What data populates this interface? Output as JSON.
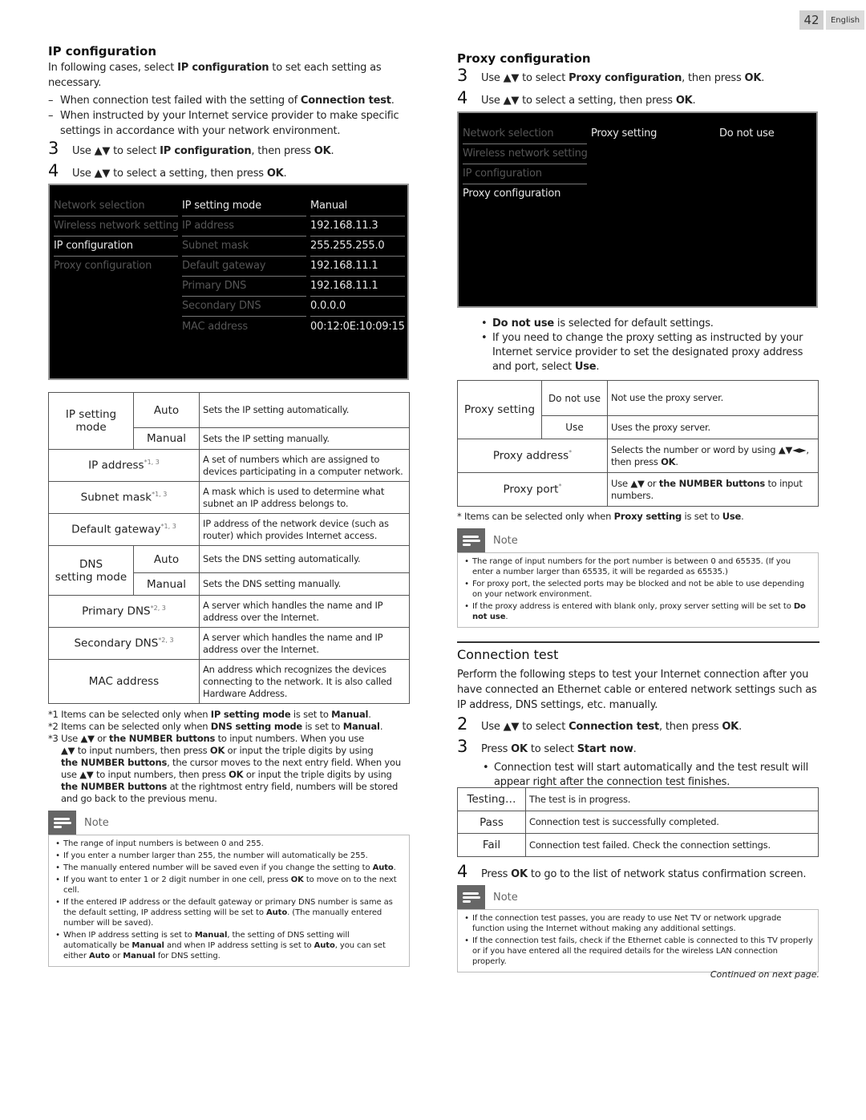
{
  "page": {
    "number": "42",
    "language": "English"
  },
  "ip_config": {
    "title": "IP configuration",
    "intro": [
      "In following cases, select ",
      "IP configuration",
      " to set each setting as necessary."
    ],
    "cases": [
      [
        "When connection test failed with the setting of ",
        "Connection test",
        "."
      ],
      [
        "When instructed by your Internet service provider to make specific settings in accordance with your network environment.",
        "",
        ""
      ]
    ],
    "steps": [
      {
        "num": "3",
        "parts": [
          "Use ▲▼ to select ",
          "IP configuration",
          ", then press ",
          "OK",
          "."
        ]
      },
      {
        "num": "4",
        "parts": [
          "Use ▲▼ to select a setting, then press ",
          "OK",
          "."
        ]
      }
    ],
    "screen": {
      "menu": [
        "Network selection",
        "Wireless network setting",
        "IP configuration",
        "Proxy configuration"
      ],
      "menu_active": 2,
      "settings": [
        {
          "label": "IP setting mode",
          "value": "Manual",
          "active": true
        },
        {
          "label": "IP address",
          "value": "192.168.11.3"
        },
        {
          "label": "Subnet mask",
          "value": "255.255.255.0"
        },
        {
          "label": "Default gateway",
          "value": "192.168.11.1"
        },
        {
          "label": "Primary DNS",
          "value": "192.168.11.1"
        },
        {
          "label": "Secondary DNS",
          "value": "0.0.0.0"
        },
        {
          "label": "MAC address",
          "value": "00:12:0E:10:09:15"
        }
      ]
    },
    "table": {
      "ip_setting_mode": {
        "label": "IP setting mode",
        "options": [
          {
            "opt": "Auto",
            "desc": "Sets the IP setting automatically."
          },
          {
            "opt": "Manual",
            "desc": "Sets the IP setting manually."
          }
        ]
      },
      "ip_address": {
        "label": "IP address",
        "fn": "*1, 3",
        "desc": "A set of numbers which are assigned to devices participating in a computer network."
      },
      "subnet_mask": {
        "label": "Subnet mask",
        "fn": "*1, 3",
        "desc": "A mask which is used to determine what subnet an IP address belongs to."
      },
      "default_gateway": {
        "label": "Default gateway",
        "fn": "*1, 3",
        "desc": "IP address of the network device (such as router) which provides Internet access."
      },
      "dns_setting_mode": {
        "label1": "DNS",
        "label2": "setting mode",
        "options": [
          {
            "opt": "Auto",
            "desc": "Sets the DNS setting automatically."
          },
          {
            "opt": "Manual",
            "desc": "Sets the DNS setting manually."
          }
        ]
      },
      "primary_dns": {
        "label": "Primary DNS",
        "fn": "*2, 3",
        "desc": "A server which handles the name and IP address over the Internet."
      },
      "secondary_dns": {
        "label": "Secondary DNS",
        "fn": "*2, 3",
        "desc": "A server which handles the name and IP address over the Internet."
      },
      "mac_address": {
        "label": "MAC address",
        "desc": "An address which recognizes the devices connecting to the network. It is also called Hardware Address."
      }
    },
    "footnotes": {
      "f1": [
        "*1 Items can be selected only when ",
        "IP setting mode",
        " is set to ",
        "Manual",
        "."
      ],
      "f2": [
        "*2 Items can be selected only when ",
        "DNS setting mode",
        " is set to ",
        "Manual",
        "."
      ],
      "f3_a": [
        "*3 Use ▲▼ or ",
        "the NUMBER buttons",
        " to input numbers. When you use"
      ],
      "f3_b": [
        "▲▼ to input numbers, then press ",
        "OK",
        " or input the triple digits by using"
      ],
      "f3_c": [
        "the NUMBER buttons",
        ", the cursor moves to the next entry field. When you"
      ],
      "f3_d": [
        "use ▲▼ to input numbers, then press ",
        "OK",
        " or input the triple digits by using"
      ],
      "f3_e": [
        "the NUMBER buttons",
        " at the rightmost entry field, numbers will be stored"
      ],
      "f3_f": [
        "and go back to the previous menu."
      ]
    },
    "note": {
      "label": "Note",
      "items": [
        [
          "The range of input numbers is between 0 and 255."
        ],
        [
          "If you enter a number larger than 255, the number will automatically be 255."
        ],
        [
          "The manually entered number will be saved even if you change the setting to ",
          "Auto",
          "."
        ],
        [
          "If you want to enter 1 or 2 digit number in one cell, press ",
          "OK",
          " to move on to the next cell."
        ],
        [
          "If the entered IP address or the default gateway or primary DNS number is same as the default setting, IP address setting will be set to ",
          "Auto",
          ". (The manually entered number will be saved)."
        ],
        [
          "When IP address setting is set to ",
          "Manual",
          ", the setting of DNS setting will automatically be ",
          "Manual",
          " and when IP address setting is set to ",
          "Auto",
          ", you can set either ",
          "Auto",
          " or ",
          "Manual",
          " for DNS setting."
        ]
      ]
    }
  },
  "proxy_config": {
    "title": "Proxy configuration",
    "steps": [
      {
        "num": "3",
        "parts": [
          "Use ▲▼ to select ",
          "Proxy configuration",
          ", then press ",
          "OK",
          "."
        ]
      },
      {
        "num": "4",
        "parts": [
          "Use ▲▼ to select a setting, then press ",
          "OK",
          "."
        ]
      }
    ],
    "screen": {
      "menu": [
        "Network selection",
        "Wireless network setting",
        "IP configuration",
        "Proxy configuration"
      ],
      "menu_active": 3,
      "setting_label": "Proxy setting",
      "setting_value": "Do not use"
    },
    "bullets": [
      [
        "",
        "Do not use",
        " is selected for default settings."
      ],
      [
        "If you need to change the proxy setting as instructed by your Internet service provider to set the designated proxy address and port, select ",
        "Use",
        "."
      ]
    ],
    "table": {
      "proxy_setting": {
        "label": "Proxy setting",
        "options": [
          {
            "opt": "Do not use",
            "desc": "Not use the proxy server."
          },
          {
            "opt": "Use",
            "desc": "Uses the proxy server."
          }
        ]
      },
      "proxy_address": {
        "label": "Proxy address",
        "fn": "*",
        "desc_parts": [
          "Selects the number or word by using ▲▼◄►, then press ",
          "OK",
          "."
        ]
      },
      "proxy_port": {
        "label": "Proxy port",
        "fn": "*",
        "desc_parts": [
          "Use ▲▼ or ",
          "the NUMBER buttons",
          " to input numbers."
        ]
      }
    },
    "footnote": [
      "* Items can be selected only when ",
      "Proxy setting",
      " is set to ",
      "Use",
      "."
    ],
    "note": {
      "label": "Note",
      "items": [
        [
          "The range of input numbers for the port number is between 0 and 65535. (If you enter a number larger than 65535, it will be regarded as 65535.)"
        ],
        [
          "For proxy port, the selected ports may be blocked and not be able to use depending on your network environment."
        ],
        [
          "If the proxy address is entered with blank only, proxy server setting will be set to ",
          "Do not use",
          "."
        ]
      ]
    }
  },
  "connection_test": {
    "title": "Connection test",
    "intro": "Perform the following steps to test your Internet connection after you have connected an Ethernet cable or entered network settings such as IP address, DNS settings, etc. manually.",
    "steps": [
      {
        "num": "2",
        "parts": [
          "Use ▲▼ to select ",
          "Connection test",
          ", then press ",
          "OK",
          "."
        ]
      },
      {
        "num": "3",
        "parts": [
          "Press ",
          "OK",
          " to select ",
          "Start now",
          "."
        ]
      }
    ],
    "bullet": "Connection test will start automatically and the test result will appear right after the connection test finishes.",
    "results": [
      {
        "status": "Testing…",
        "desc": "The test is in progress."
      },
      {
        "status": "Pass",
        "desc": "Connection test is successfully completed."
      },
      {
        "status": "Fail",
        "desc": "Connection test failed. Check the connection settings."
      }
    ],
    "step4": {
      "num": "4",
      "parts": [
        "Press ",
        "OK",
        " to go to the list of network status confirmation screen."
      ]
    },
    "note": {
      "label": "Note",
      "items": [
        [
          "If the connection test passes, you are ready to use Net TV or network upgrade function using the Internet without making any additional settings."
        ],
        [
          "If the connection test fails, check if the Ethernet cable is connected to this TV properly or if you have entered all the required details for the wireless LAN connection properly."
        ]
      ]
    },
    "continued": "Continued on next page."
  }
}
